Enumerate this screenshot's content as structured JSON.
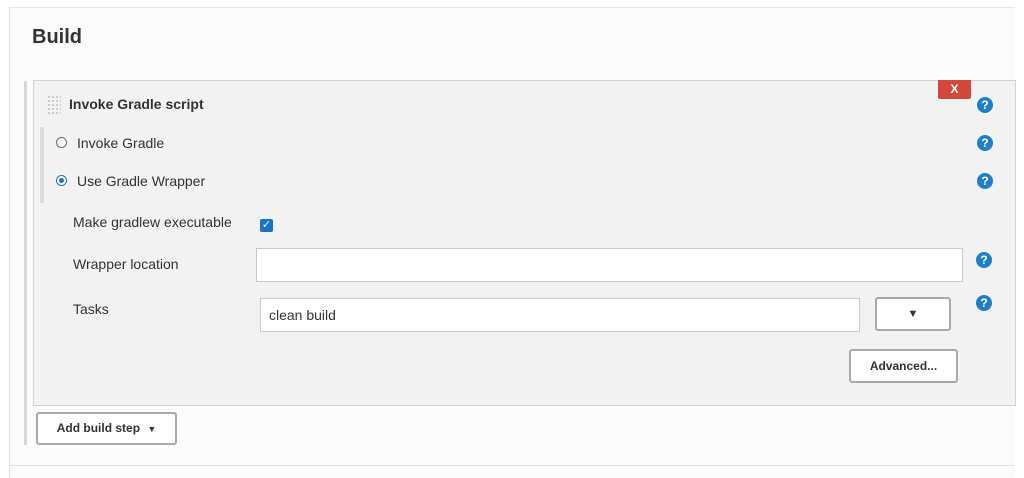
{
  "section": {
    "title": "Build"
  },
  "step": {
    "title": "Invoke Gradle script",
    "delete_label": "X",
    "help_glyph": "?"
  },
  "radios": {
    "invoke_gradle": "Invoke Gradle",
    "use_wrapper": "Use Gradle Wrapper",
    "selected": "use_wrapper"
  },
  "options": {
    "make_executable_label": "Make gradlew executable",
    "make_executable_checked": true,
    "wrapper_location_label": "Wrapper location",
    "wrapper_location_value": "",
    "tasks_label": "Tasks",
    "tasks_value": "clean build",
    "tasks_dropdown_glyph": "▼"
  },
  "buttons": {
    "advanced": "Advanced...",
    "add_build_step": "Add build step",
    "add_build_step_caret": "▼"
  },
  "colors": {
    "accent": "#1a73c9",
    "help": "#1e7fcb",
    "danger": "#d24939"
  }
}
